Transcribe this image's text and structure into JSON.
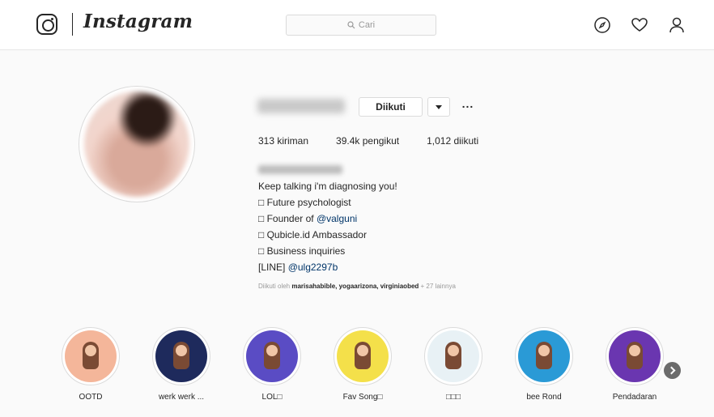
{
  "header": {
    "wordmark": "Instagram",
    "search_placeholder": "Cari",
    "icons": [
      "instagram-glyph-icon",
      "compass-icon",
      "heart-icon",
      "user-icon",
      "search-icon"
    ]
  },
  "profile": {
    "follow_button": "Diikuti",
    "stats": {
      "posts": "313 kiriman",
      "followers": "39.4k pengikut",
      "following": "1,012 diikuti"
    },
    "bio": [
      {
        "text": "Keep talking i'm diagnosing you!"
      },
      {
        "text": "□ Future psychologist"
      },
      {
        "prefix": "□ Founder of ",
        "link": "@valguni"
      },
      {
        "text": "□ Qubicle.id Ambassador"
      },
      {
        "text": "□ Business inquiries"
      },
      {
        "prefix": "[LINE] ",
        "link": "@ulg2297b"
      }
    ],
    "followed_by": {
      "prefix": "Diikuti oleh ",
      "names": "marisahabible, yogaarizona, virginiaobed",
      "suffix": " + 27 lainnya"
    }
  },
  "highlights": [
    {
      "label": "OOTD",
      "bg": "#f4b69a"
    },
    {
      "label": "werk werk ...",
      "bg": "#1e2a5c"
    },
    {
      "label": "LOL□",
      "bg": "#5a4cc4"
    },
    {
      "label": "Fav Song□",
      "bg": "#f4e04a"
    },
    {
      "label": "□□□",
      "bg": "#e8f1f5"
    },
    {
      "label": "bee Rond",
      "bg": "#2a9ad6"
    },
    {
      "label": "Pendadaran",
      "bg": "#6a36b0"
    }
  ],
  "colors": {
    "link": "#003569",
    "border": "#dbdbdb",
    "background": "#fafafa"
  }
}
